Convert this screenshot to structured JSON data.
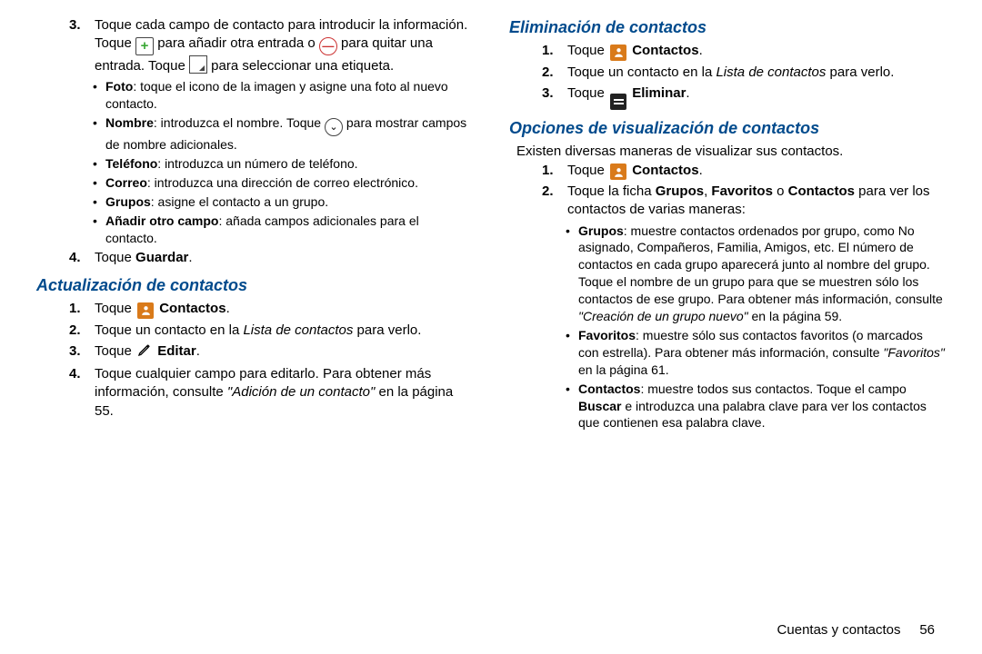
{
  "left": {
    "step3": {
      "num": "3.",
      "t1": "Toque cada campo de contacto para introducir la información. Toque ",
      "t2": " para añadir otra entrada o ",
      "t3": " para quitar una entrada. Toque ",
      "t4": " para seleccionar una etiqueta."
    },
    "bullets3": {
      "foto_b": "Foto",
      "foto_t": ": toque el icono de la imagen y asigne una foto al nuevo contacto.",
      "nombre_b": "Nombre",
      "nombre_t1": ": introduzca el nombre. Toque ",
      "nombre_t2": " para mostrar campos de nombre adicionales.",
      "tel_b": "Teléfono",
      "tel_t": ": introduzca un número de teléfono.",
      "correo_b": "Correo",
      "correo_t": ": introduzca una dirección de correo electrónico.",
      "grupos_b": "Grupos",
      "grupos_t": ": asigne el contacto a un grupo.",
      "otro_b": "Añadir otro campo",
      "otro_t": ": añada campos adicionales para el contacto."
    },
    "step4": {
      "num": "4.",
      "t1": "Toque ",
      "b": "Guardar",
      "t2": "."
    },
    "h_actualizacion": "Actualización de contactos",
    "act": {
      "s1": {
        "num": "1.",
        "t1": "Toque ",
        "b": "Contactos",
        "t2": "."
      },
      "s2": {
        "num": "2.",
        "t1": "Toque un contacto en la ",
        "i": "Lista de contactos",
        "t2": " para verlo."
      },
      "s3": {
        "num": "3.",
        "t1": "Toque ",
        "b": "Editar",
        "t2": "."
      },
      "s4": {
        "num": "4.",
        "t1": "Toque cualquier campo para editarlo. Para obtener más información, consulte ",
        "i": "\"Adición de un contacto\"",
        "t2": " en la página 55."
      }
    }
  },
  "right": {
    "h_eliminacion": "Eliminación de contactos",
    "elim": {
      "s1": {
        "num": "1.",
        "t1": "Toque ",
        "b": "Contactos",
        "t2": "."
      },
      "s2": {
        "num": "2.",
        "t1": "Toque un contacto en la ",
        "i": "Lista de contactos",
        "t2": " para verlo."
      },
      "s3": {
        "num": "3.",
        "t1": "Toque ",
        "b": "Eliminar",
        "t2": "."
      }
    },
    "h_opciones": "Opciones de visualización de contactos",
    "op_intro": "Existen diversas maneras de visualizar sus contactos.",
    "op": {
      "s1": {
        "num": "1.",
        "t1": "Toque ",
        "b": "Contactos",
        "t2": "."
      },
      "s2": {
        "num": "2.",
        "t1": "Toque la ficha ",
        "b1": "Grupos",
        "c1": ", ",
        "b2": "Favoritos",
        "c2": " o ",
        "b3": "Contactos",
        "t2": " para ver los contactos de varias maneras:"
      }
    },
    "op_bullets": {
      "grupos_b": "Grupos",
      "grupos_t1": ": muestre contactos ordenados por grupo, como No asignado, Compañeros, Familia, Amigos, etc. El número de contactos en cada grupo aparecerá junto al nombre del grupo. Toque el nombre de un grupo para que se muestren sólo los contactos de ese grupo. Para obtener más información, consulte ",
      "grupos_i": "\"Creación de un grupo nuevo\"",
      "grupos_t2": " en la página 59.",
      "fav_b": "Favoritos",
      "fav_t1": ": muestre sólo sus contactos favoritos (o marcados con estrella). Para obtener más información, consulte ",
      "fav_i": "\"Favoritos\"",
      "fav_t2": " en la página 61.",
      "con_b": "Contactos",
      "con_t1": ": muestre todos sus contactos. Toque el campo ",
      "con_b2": "Buscar",
      "con_t2": " e introduzca una palabra clave para ver los contactos que contienen esa palabra clave."
    }
  },
  "footer": {
    "label": "Cuentas y contactos",
    "page": "56"
  }
}
